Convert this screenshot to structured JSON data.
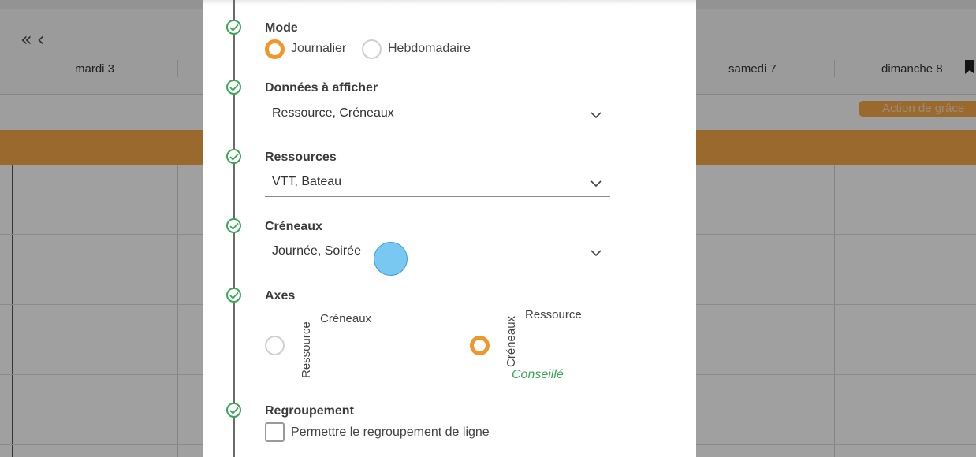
{
  "calendar": {
    "days": [
      "mardi 3",
      "samedi 7",
      "dimanche 8"
    ],
    "event_label": "Action de grâce",
    "nav_icons": [
      "double-chevron-left-icon",
      "chevron-left-icon"
    ],
    "accent_color": "#f0a449"
  },
  "modal": {
    "mode": {
      "title": "Mode",
      "options": [
        {
          "label": "Journalier",
          "selected": true
        },
        {
          "label": "Hebdomadaire",
          "selected": false
        }
      ]
    },
    "data_display": {
      "title": "Données à afficher",
      "value": "Ressource, Créneaux"
    },
    "resources": {
      "title": "Ressources",
      "value": "VTT, Bateau"
    },
    "slots": {
      "title": "Créneaux",
      "value": "Journée, Soirée",
      "focused": true
    },
    "axes": {
      "title": "Axes",
      "option_a": {
        "horizontal": "Créneaux",
        "vertical": "Ressource",
        "selected": false
      },
      "option_b": {
        "horizontal": "Ressource",
        "vertical": "Créneaux",
        "selected": true,
        "note": "Conseillé"
      }
    },
    "grouping": {
      "title": "Regroupement",
      "checkbox_label": "Permettre le regroupement de ligne",
      "checked": false
    },
    "colors": {
      "step_check": "#3aa655",
      "radio_selected": "#f0962a",
      "focus_underline": "#2aa1d6"
    }
  }
}
